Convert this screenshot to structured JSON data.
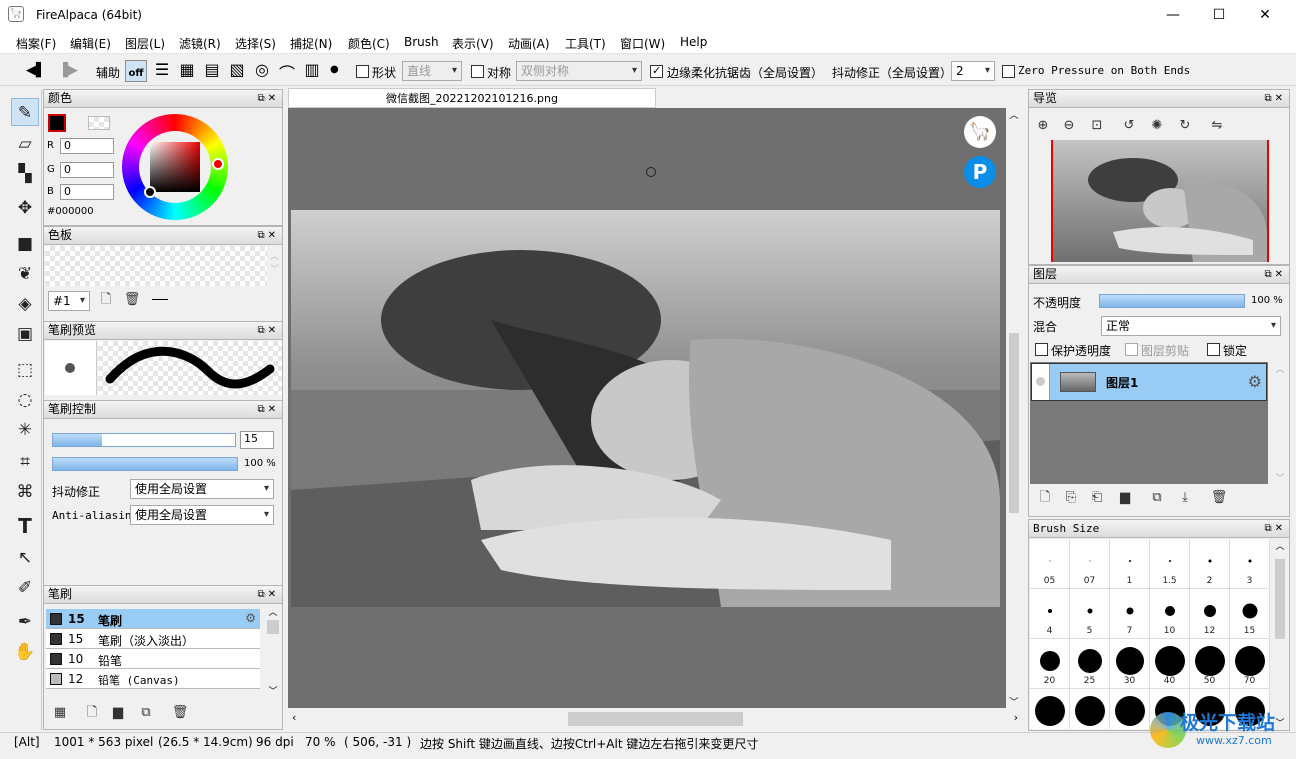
{
  "window": {
    "title": "FireAlpaca (64bit)",
    "minimize": "—",
    "maximize": "☐",
    "close": "✕"
  },
  "menu": [
    "档案(F)",
    "编辑(E)",
    "图层(L)",
    "滤镜(R)",
    "选择(S)",
    "捕捉(N)",
    "颜色(C)",
    "Brush",
    "表示(V)",
    "动画(A)",
    "工具(T)",
    "窗口(W)",
    "Help"
  ],
  "toolbar": {
    "assist_label": "辅助",
    "off_label": "off",
    "shape_label": "形状",
    "shape_value": "直线",
    "symmetry_label": "对称",
    "symmetry_value": "双侧对称",
    "antialias_label": "边缘柔化抗锯齿（全局设置）",
    "stabilizer_label": "抖动修正（全局设置）",
    "stabilizer_value": "2",
    "zero_pressure_label": "Zero Pressure on Both Ends"
  },
  "color_panel": {
    "title": "颜色",
    "r_label": "R",
    "g_label": "G",
    "b_label": "B",
    "r": "0",
    "g": "0",
    "b": "0",
    "hex": "#000000"
  },
  "palette_panel": {
    "title": "色板",
    "index": "#1"
  },
  "brush_preview": {
    "title": "笔刷预览"
  },
  "brush_control": {
    "title": "笔刷控制",
    "size": "15",
    "size_fraction": 0.27,
    "opacity": "100",
    "percent": "%",
    "stabilizer_label": "抖动修正",
    "stabilizer_value": "使用全局设置",
    "antialias_label": "Anti-aliasin",
    "antialias_value": "使用全局设置"
  },
  "brush_panel": {
    "title": "笔刷",
    "items": [
      {
        "size": "15",
        "name": "笔刷"
      },
      {
        "size": "15",
        "name": "笔刷（淡入淡出）"
      },
      {
        "size": "10",
        "name": "铅笔"
      },
      {
        "size": "12",
        "name": "铅笔 (Canvas)"
      }
    ]
  },
  "document": {
    "tab_title": "微信截图_20221202101216.png"
  },
  "navigator": {
    "title": "导览"
  },
  "layer_panel": {
    "title": "图层",
    "opacity_label": "不透明度",
    "opacity_value": "100",
    "percent": "%",
    "blend_label": "混合",
    "blend_value": "正常",
    "protect_alpha": "保护透明度",
    "clipping": "图层剪贴",
    "lock": "锁定",
    "layer_name": "图层1"
  },
  "brush_size_panel": {
    "title": "Brush Size",
    "sizes": [
      "05",
      "07",
      "1",
      "1.5",
      "2",
      "3",
      "4",
      "5",
      "7",
      "10",
      "12",
      "15",
      "20",
      "25",
      "30",
      "40",
      "50",
      "70",
      "",
      "",
      "",
      "",
      "",
      ""
    ]
  },
  "status": {
    "alt": "[Alt]",
    "pixels": "1001 * 563 pixel",
    "cm": "(26.5 * 14.9cm)",
    "dpi": "96 dpi",
    "zoom": "70 %",
    "coords": "( 506, -31 )",
    "hint": "边按 Shift 键边画直线、边按Ctrl+Alt 键边左右拖引来变更尺寸"
  },
  "watermark": {
    "text": "极光下载站",
    "url": "www.xz7.com"
  }
}
